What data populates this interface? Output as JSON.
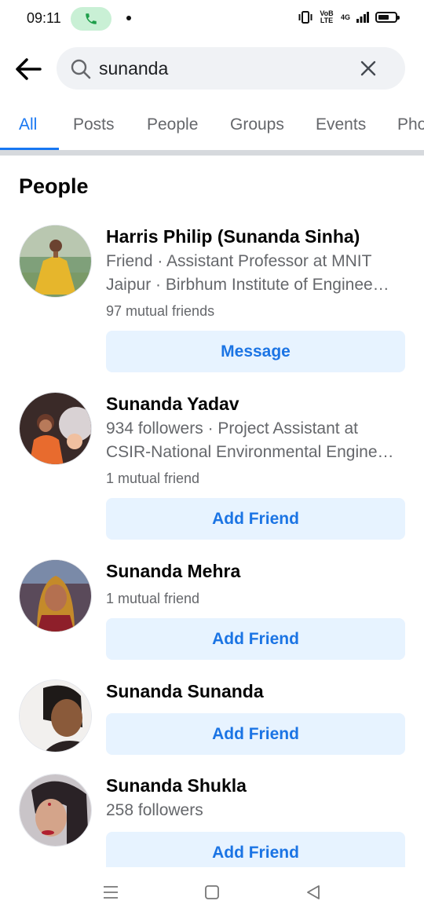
{
  "status_bar": {
    "time": "09:11",
    "network_label_1": "VoB LTE",
    "network_label_2": "4G",
    "icons": [
      "phone-call-icon",
      "vibrate-icon",
      "signal-icon",
      "battery-icon"
    ]
  },
  "search": {
    "query": "sunanda",
    "back_icon": "arrow-left-icon",
    "search_icon": "search-icon",
    "clear_icon": "close-icon"
  },
  "tabs": [
    {
      "label": "All",
      "active": true
    },
    {
      "label": "Posts",
      "active": false
    },
    {
      "label": "People",
      "active": false
    },
    {
      "label": "Groups",
      "active": false
    },
    {
      "label": "Events",
      "active": false
    },
    {
      "label": "Pho",
      "active": false
    }
  ],
  "section": {
    "title": "People"
  },
  "people": [
    {
      "name": "Harris Philip (Sunanda Sinha)",
      "line1": "Friend · Assistant Professor at MNIT",
      "line2": "Jaipur · Birbhum Institute of Enginee…",
      "mutual": "97 mutual friends",
      "button": "Message"
    },
    {
      "name": "Sunanda Yadav",
      "line1": "934 followers · Project Assistant at",
      "line2": "CSIR-National Environmental Engine…",
      "mutual": "1 mutual friend",
      "button": "Add Friend"
    },
    {
      "name": "Sunanda Mehra",
      "mutual": "1 mutual friend",
      "button": "Add Friend"
    },
    {
      "name": "Sunanda Sunanda",
      "button": "Add Friend"
    },
    {
      "name": "Sunanda Shukla",
      "line1": "258 followers",
      "button": "Add Friend"
    }
  ],
  "nav": {
    "icons": [
      "menu-icon",
      "home-square-icon",
      "back-triangle-icon"
    ]
  },
  "colors": {
    "accent": "#1877f2",
    "button_bg": "#e7f3ff",
    "button_text": "#1b74e4",
    "secondary_text": "#65676b",
    "call_pill": "#c9f0d5"
  }
}
